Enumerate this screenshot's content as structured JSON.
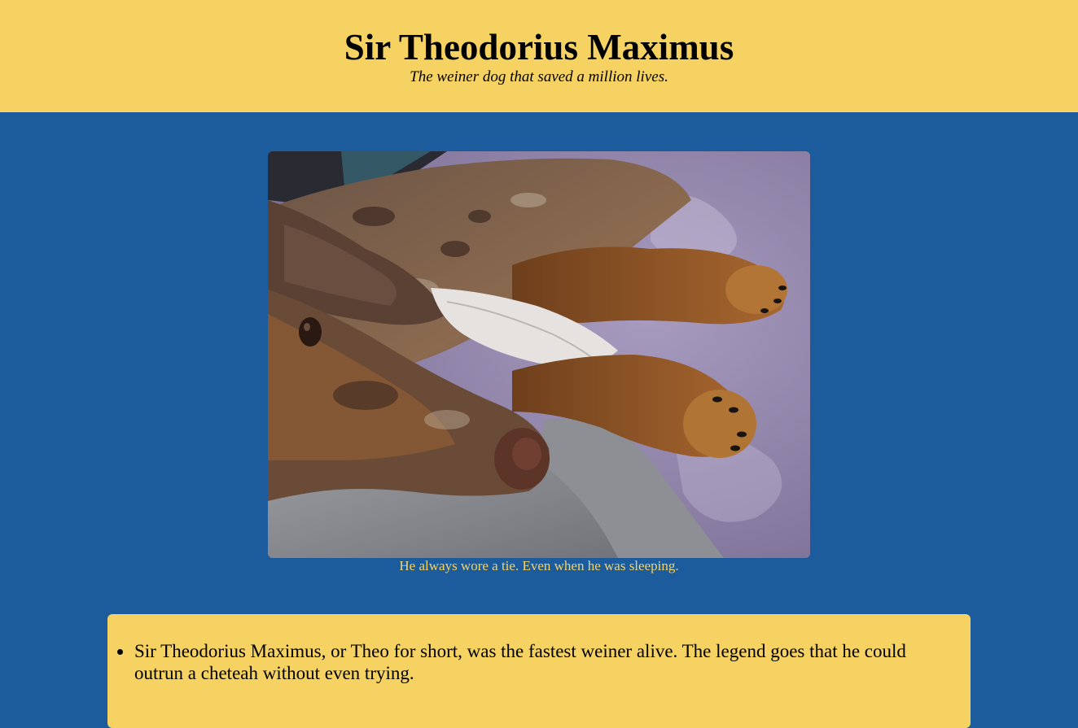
{
  "header": {
    "title": "Sir Theodorius Maximus",
    "tagline": "The weiner dog that saved a million lives."
  },
  "colors": {
    "header_bg": "#f5d262",
    "page_bg": "#1c5c9c",
    "caption_text": "#f5d262",
    "card_bg": "#f5d262"
  },
  "photo": {
    "caption": "He always wore a tie. Even when he was sleeping."
  },
  "facts": {
    "items": [
      {
        "text": "Sir Theodorius Maximus, or Theo for short, was the fastest weiner alive. The legend goes that he could outrun a cheteah without even trying."
      }
    ]
  }
}
